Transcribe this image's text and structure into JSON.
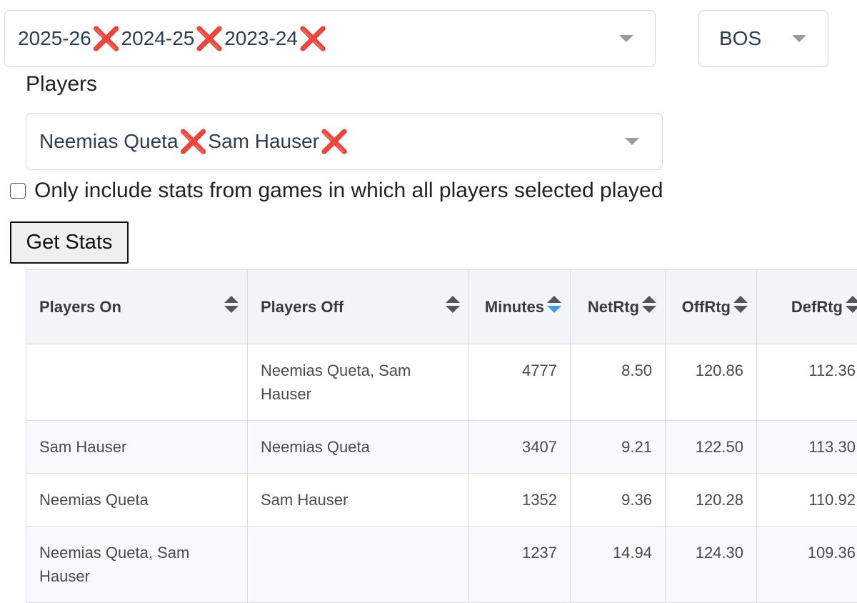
{
  "filters": {
    "seasons": [
      "2025-26",
      "2024-25",
      "2023-24"
    ],
    "team": "BOS",
    "players_label": "Players",
    "players": [
      "Neemias Queta",
      "Sam Hauser"
    ],
    "remove_glyph": "❌"
  },
  "checkbox": {
    "label": "Only include stats from games in which all players selected played",
    "checked": false
  },
  "get_stats_label": "Get Stats",
  "table": {
    "columns": [
      "Players On",
      "Players Off",
      "Minutes",
      "NetRtg",
      "OffRtg",
      "DefRtg"
    ],
    "sorted_column": "Minutes",
    "sort_direction": "descending",
    "rows": [
      [
        "",
        "Neemias Queta, Sam Hauser",
        "4777",
        "8.50",
        "120.86",
        "112.36"
      ],
      [
        "Sam Hauser",
        "Neemias Queta",
        "3407",
        "9.21",
        "122.50",
        "113.30"
      ],
      [
        "Neemias Queta",
        "Sam Hauser",
        "1352",
        "9.36",
        "120.28",
        "110.92"
      ],
      [
        "Neemias Queta, Sam Hauser",
        "",
        "1237",
        "14.94",
        "124.30",
        "109.36"
      ]
    ]
  },
  "colors": {
    "remove_x": "#dd1111",
    "sort_active": "#3b9cf0",
    "header_bg": "#f3f4f8"
  }
}
